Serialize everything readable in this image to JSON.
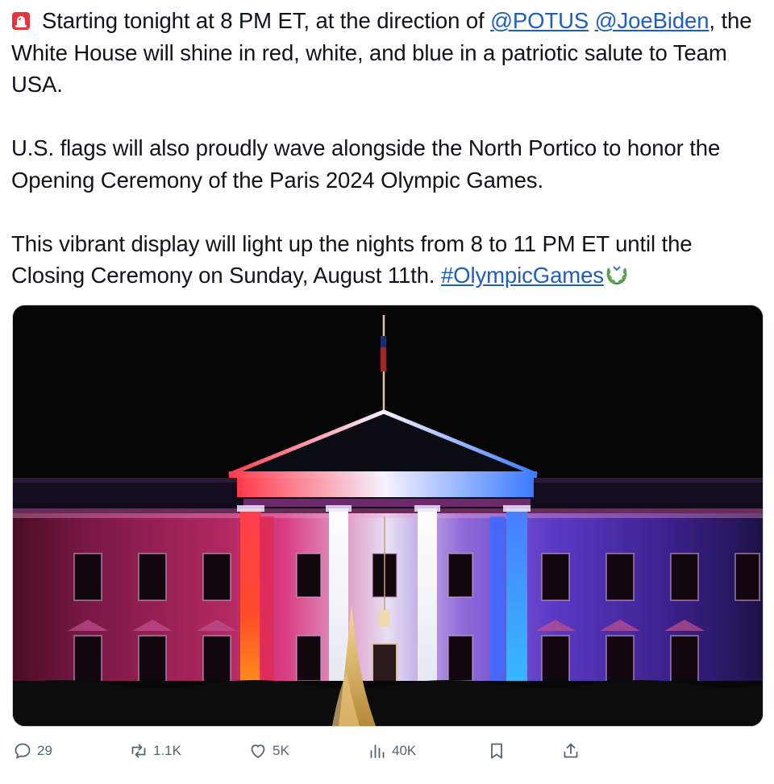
{
  "tweet": {
    "paragraphs": [
      {
        "before": "Starting tonight at 8 PM ET, at the direction of ",
        "mention1": "@POTUS",
        "space": " ",
        "mention2": "@JoeBiden",
        "after": ", the White House will shine in red, white, and blue in a patriotic salute to Team USA."
      },
      {
        "text": "U.S. flags will also proudly wave alongside the North Portico to honor the Opening Ceremony of the Paris 2024 Olympic Games."
      },
      {
        "text": "This vibrant display will light up the nights from 8 to 11 PM ET until the Closing Ceremony on Sunday, August 11th. ",
        "hashtag": "#OlympicGames"
      }
    ],
    "leading_emoji": "siren-emoji",
    "trailing_emoji": "laurel-wreath-emoji",
    "link_color": "#1d5fbf"
  },
  "media": {
    "subject": "white-house-lit-red-white-blue",
    "colors": {
      "red": "#ff2a3a",
      "pink": "#e03a9a",
      "white": "#f4f4ff",
      "blue": "#3a6dff",
      "violet": "#6a32e0",
      "sky": "#050505"
    }
  },
  "actions": {
    "replies": {
      "icon": "reply-icon",
      "count": "29"
    },
    "reposts": {
      "icon": "repost-icon",
      "count": "1.1K"
    },
    "likes": {
      "icon": "heart-icon",
      "count": "5K"
    },
    "views": {
      "icon": "views-icon",
      "count": "40K"
    },
    "bookmark": {
      "icon": "bookmark-icon"
    },
    "share": {
      "icon": "share-icon"
    },
    "icon_color": "#536471"
  }
}
